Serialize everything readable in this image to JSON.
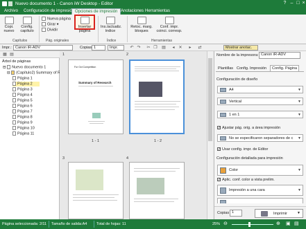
{
  "window": {
    "title": "Nuevo documento 1 - Canon iW Desktop - Editor"
  },
  "tabs": [
    "Archivo",
    "Configuración de impresión",
    "Opciones de impresión",
    "Anotaciones",
    "Herramientas"
  ],
  "ribbon": {
    "copiar_nuevo": "Copi. nuevo",
    "config_capitulo": "Config. capítulo",
    "insertar_capitulo_group": "Capítulos",
    "nueva_pagina": "Nueva página",
    "girar": "Girar",
    "dividir": "Dividir",
    "pag_originales_group": "Pág. originales",
    "insertar_pagina": "Insertar página",
    "insertar_indice": "Ins./actualiz. índice",
    "indice_group": "Índice",
    "retoc_marg": "Retoc. marg. bloques",
    "conf_impr": "Conf. impr. coinci. corresp.",
    "herramientas_group": "Herramientas"
  },
  "toolbar": {
    "printer_label": "Impr.:",
    "printer_value": "Canon iR-ADV",
    "copies_label": "Copias:",
    "copies_value": "1",
    "impr_btn": "Impr.",
    "mostrar_anotac": "Mostrar anotac."
  },
  "tree": {
    "header": "Árbol de páginas",
    "root": "Nuevo documento 1",
    "chapter": "(Capítulo2) Summary of R",
    "pages": [
      "Página 1",
      "Página 2",
      "Página 3",
      "Página 4",
      "Página 5",
      "Página 6",
      "Página 7",
      "Página 8",
      "Página 9",
      "Página 10",
      "Página 11"
    ]
  },
  "thumbs": {
    "n1": "1",
    "n2": "2",
    "n3": "3",
    "n4": "4",
    "l1": "1 - 1",
    "l2": "1 - 2",
    "p1_title": "Summary of Research",
    "p1_head": "For Oct Competition"
  },
  "right": {
    "printer_name_label": "Nombre de la impresora:",
    "printer_name": "Canon iR-ADV",
    "tabs": [
      "Plantillas",
      "Config. Impresión",
      "Config. Página"
    ],
    "diseno_label": "Configuración de diseño",
    "paper": "A4",
    "orientation": "Vertical",
    "layout": "1 en 1",
    "ajustar": "Ajustar pág. orig. a área impresión",
    "separadores": "No se especificaron separadores de c",
    "usar_config": "Usar config. impr. de Editor",
    "detallada_label": "Configuración detallada para impresión",
    "color": "Color",
    "aplic_color": "Aplic. conf. color a vista prelim.",
    "impresion_cara": "Impresión a una cara",
    "copies_label": "Copias",
    "copies_value": "1",
    "imprimir": "Imprimir"
  },
  "status": {
    "selected": "Página seleccionada: 2/11",
    "size": "Tamaño de salida:A4",
    "total": "Total de hojas: 11",
    "zoom": "25%"
  }
}
